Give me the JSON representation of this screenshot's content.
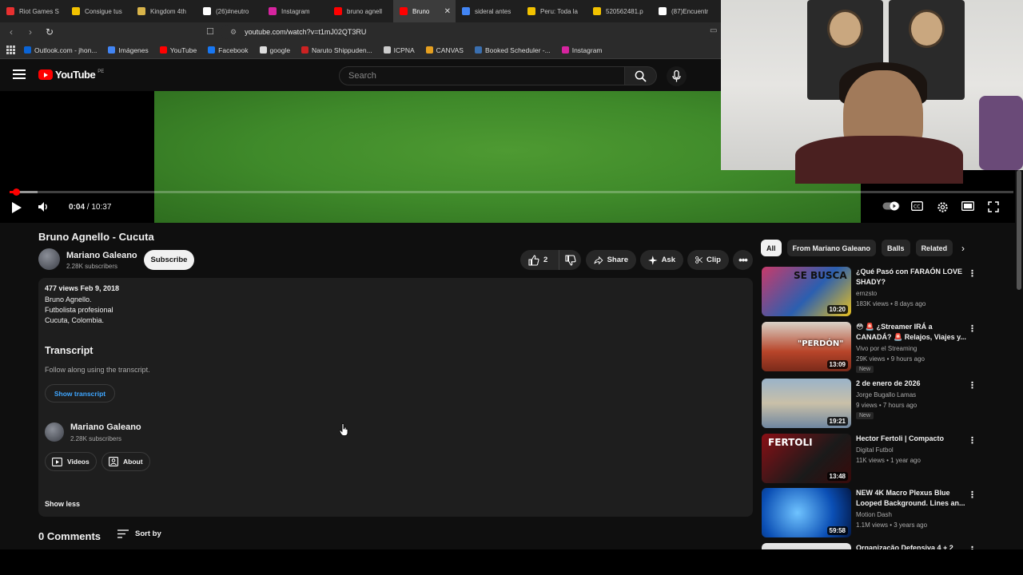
{
  "browser": {
    "tabs": [
      {
        "label": "Riot Games S",
        "color": "#e83030"
      },
      {
        "label": "Consigue tus",
        "color": "#f2c200"
      },
      {
        "label": "Kingdom 4th",
        "color": "#d9b44a"
      },
      {
        "label": "(26)#neutro",
        "color": "#ffffff"
      },
      {
        "label": "Instagram",
        "color": "#d6249f"
      },
      {
        "label": "bruno agnell",
        "color": "#ff0000"
      },
      {
        "label": "Bruno",
        "color": "#ff0000"
      },
      {
        "label": "sideral antes",
        "color": "#4285f4"
      },
      {
        "label": "Peru: Toda la",
        "color": "#f2c200"
      },
      {
        "label": "520562481.p",
        "color": "#f2c200"
      },
      {
        "label": "(87)Encuentr",
        "color": "#ffffff"
      }
    ],
    "url": "youtube.com/watch?v=t1mJ02QT3RU",
    "bookmarks": [
      {
        "label": "Outlook.com - jhon...",
        "color": "#0a64d6"
      },
      {
        "label": "Imágenes",
        "color": "#4285f4"
      },
      {
        "label": "YouTube",
        "color": "#ff0000"
      },
      {
        "label": "Facebook",
        "color": "#1877f2"
      },
      {
        "label": "google",
        "color": "#dddddd"
      },
      {
        "label": "Naruto Shippuden...",
        "color": "#cc2222"
      },
      {
        "label": "ICPNA",
        "color": "#cccccc"
      },
      {
        "label": "CANVAS",
        "color": "#e6a020"
      },
      {
        "label": "Booked Scheduler -...",
        "color": "#3a6fb0"
      },
      {
        "label": "Instagram",
        "color": "#d6249f"
      }
    ]
  },
  "header": {
    "logo_word": "YouTube",
    "country_code": "PE",
    "search_placeholder": "Search"
  },
  "player": {
    "current_time": "0:04",
    "separator": " / ",
    "duration": "10:37",
    "progress_fraction": 0.006,
    "buffer_fraction": 0.028
  },
  "video": {
    "title": "Bruno Agnello - Cucuta",
    "channel": "Mariano Galeano",
    "subscribers": "2.28K subscribers",
    "subscribe_label": "Subscribe",
    "likes": "2",
    "share_label": "Share",
    "ask_label": "Ask",
    "clip_label": "Clip"
  },
  "description": {
    "stats": "477 views  Feb 9, 2018",
    "lines": [
      "Bruno Agnello.",
      "Futbolista profesional",
      "Cucuta, Colombia."
    ],
    "transcript_heading": "Transcript",
    "transcript_sub": "Follow along using the transcript.",
    "transcript_button": "Show transcript",
    "channel": "Mariano Galeano",
    "subscribers": "2.28K subscribers",
    "videos_label": "Videos",
    "about_label": "About",
    "show_less": "Show less"
  },
  "comments": {
    "heading": "0 Comments",
    "sort_label": "Sort by"
  },
  "sidebar": {
    "chips": [
      "All",
      "From Mariano Galeano",
      "Balls",
      "Related"
    ],
    "videos": [
      {
        "title": "¿Qué Pasó con FARAÓN LOVE SHADY?",
        "channel": "ernzsto",
        "meta": "183K views • 8 days ago",
        "duration": "10:20",
        "badge": "",
        "thumb_text": "SE BUSCA"
      },
      {
        "title": "😳 🚨 ¿Streamer IRÁ a CANADÁ? 🚨 Relajos, Viajes y...",
        "channel": "Vivo por el Streaming",
        "meta": "29K views • 9 hours ago",
        "duration": "13:09",
        "badge": "New",
        "thumb_text": "\"PERDÓN\""
      },
      {
        "title": "2 de enero de 2026",
        "channel": "Jorge Bugallo Lamas",
        "meta": "9 views • 7 hours ago",
        "duration": "19:21",
        "badge": "New",
        "thumb_text": ""
      },
      {
        "title": "Hector Fertoli | Compacto",
        "channel": "Digital Futbol",
        "meta": "11K views • 1 year ago",
        "duration": "13:48",
        "badge": "",
        "thumb_text": "FERTOLI"
      },
      {
        "title": "NEW 4K Macro Plexus Blue Looped Background. Lines an...",
        "channel": "Motion Dash",
        "meta": "1.1M views • 3 years ago",
        "duration": "59:58",
        "badge": "",
        "thumb_text": ""
      },
      {
        "title": "Organização Defensiva 4 + 2",
        "channel": "",
        "meta": "",
        "duration": "",
        "badge": "",
        "thumb_text": ""
      }
    ]
  }
}
